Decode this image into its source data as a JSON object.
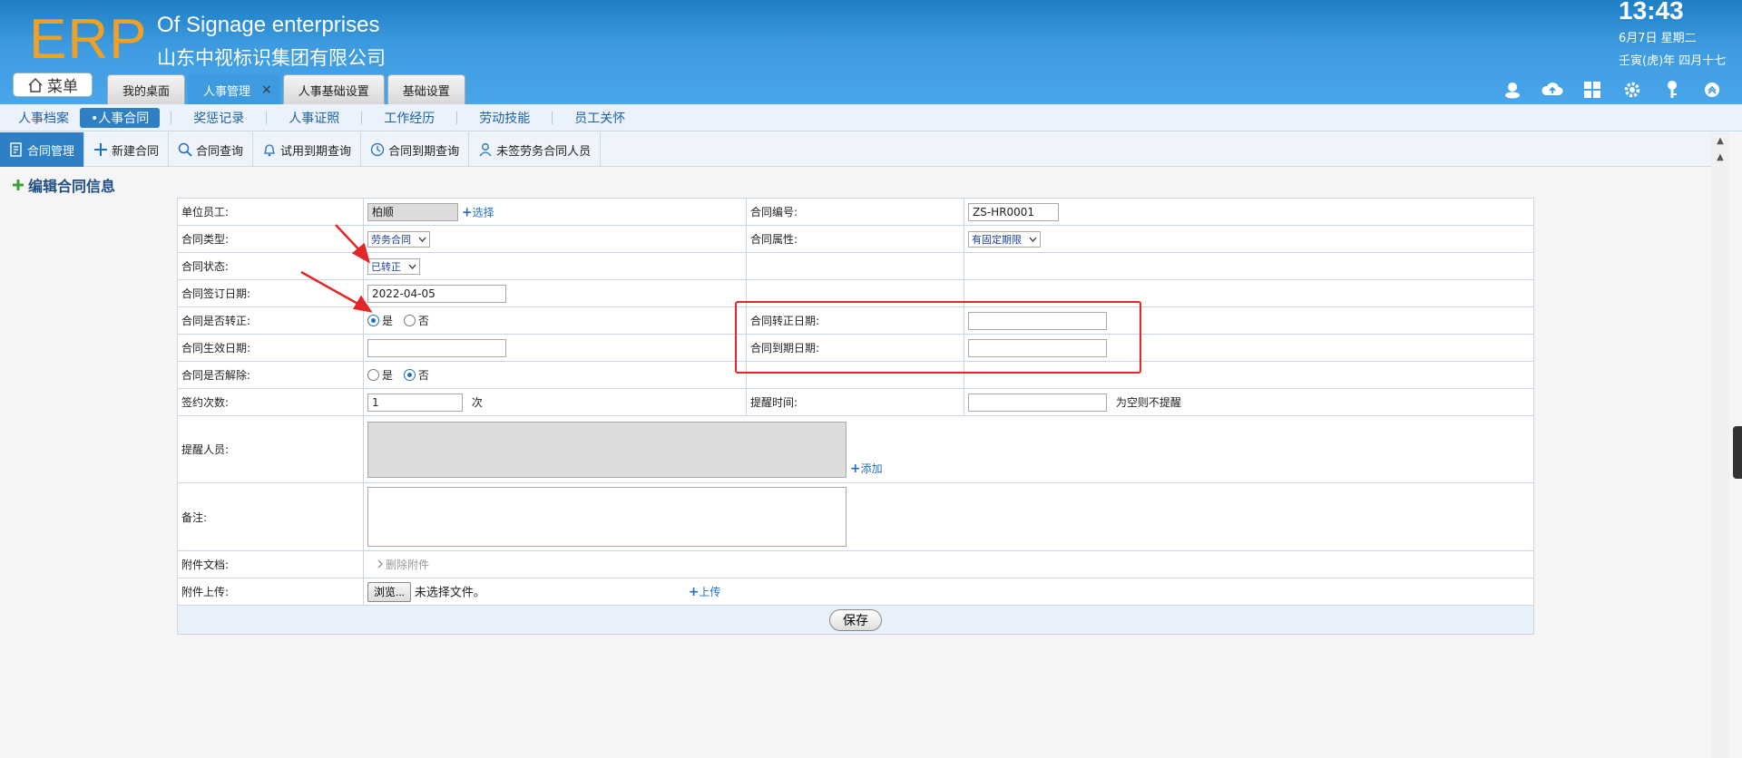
{
  "header": {
    "logo": "ERP",
    "company_en": "Of Signage enterprises",
    "company_cn": "山东中视标识集团有限公司",
    "time": "13:43",
    "date": "6月7日 星期二",
    "lunar": "壬寅(虎)年 四月十七",
    "menu_label": "菜单",
    "tabs": [
      {
        "label": "我的桌面"
      },
      {
        "label": "人事管理",
        "close": "×"
      },
      {
        "label": "人事基础设置"
      },
      {
        "label": "基础设置"
      }
    ],
    "icons": [
      "user-icon",
      "cloud-icon",
      "grid-icon",
      "gear-icon",
      "key-icon",
      "collapse-icon"
    ]
  },
  "subnav": {
    "items": [
      "人事档案",
      "•人事合同",
      "奖惩记录",
      "人事证照",
      "工作经历",
      "劳动技能",
      "员工关怀"
    ]
  },
  "toolbar": {
    "items": [
      "合同管理",
      "新建合同",
      "合同查询",
      "试用到期查询",
      "合同到期查询",
      "未签劳务合同人员"
    ]
  },
  "section_title": "编辑合同信息",
  "form": {
    "employee_label": "单位员工:",
    "employee_value": "柏顺",
    "select_link": "选择",
    "contract_no_label": "合同编号:",
    "contract_no_value": "ZS-HR0001",
    "type_label": "合同类型:",
    "type_value": "劳务合同",
    "attr_label": "合同属性:",
    "attr_value": "有固定期限",
    "status_label": "合同状态:",
    "status_value": "已转正",
    "sign_date_label": "合同签订日期:",
    "sign_date_value": "2022-04-05",
    "regular_label": "合同是否转正:",
    "yes": "是",
    "no": "否",
    "regular_date_label": "合同转正日期:",
    "effective_date_label": "合同生效日期:",
    "expire_date_label": "合同到期日期:",
    "terminate_label": "合同是否解除:",
    "sign_count_label": "签约次数:",
    "sign_count_value": "1",
    "sign_count_unit": "次",
    "remind_time_label": "提醒时间:",
    "remind_time_hint": "为空则不提醒",
    "remind_person_label": "提醒人员:",
    "add_link": "添加",
    "remark_label": "备注:",
    "attach_label": "附件文档:",
    "delete_attach": "删除附件",
    "upload_label": "附件上传:",
    "browse": "浏览...",
    "no_file": "未选择文件。",
    "upload_link": "上传",
    "save": "保存"
  }
}
